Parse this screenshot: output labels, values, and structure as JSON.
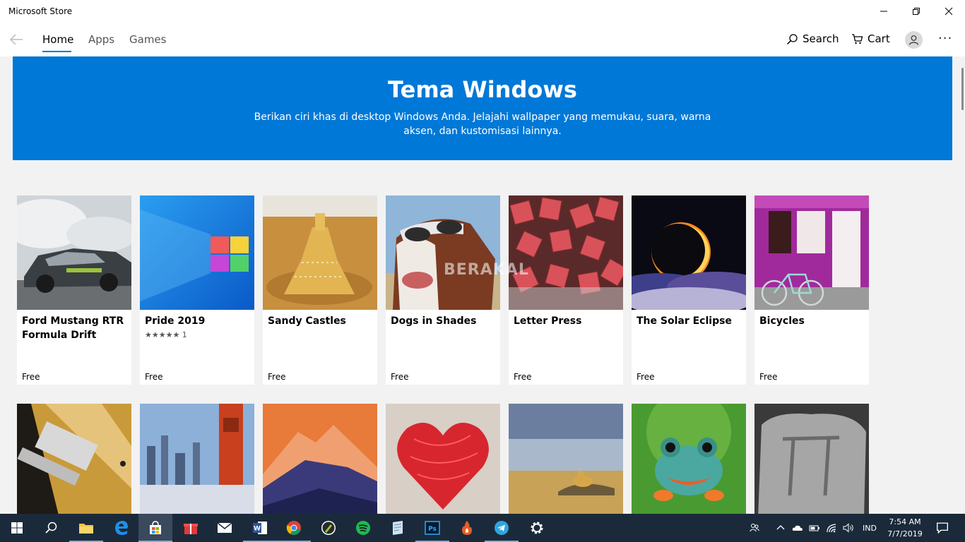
{
  "window": {
    "title": "Microsoft Store"
  },
  "nav": {
    "tabs": [
      {
        "label": "Home"
      },
      {
        "label": "Apps"
      },
      {
        "label": "Games"
      }
    ],
    "search_label": "Search",
    "cart_label": "Cart",
    "more_label": "···"
  },
  "hero": {
    "title": "Tema Windows",
    "description": "Berikan ciri khas di desktop Windows Anda. Jelajahi wallpaper yang memukau, suara, warna aksen, dan kustomisasi lainnya.",
    "color": "#0078d7"
  },
  "watermark": "BERAKAL",
  "row1": [
    {
      "name": "Ford Mustang RTR Formula Drift",
      "price": "Free",
      "icon": "car-drift-image"
    },
    {
      "name": "Pride 2019",
      "rating": "★★★★★ 1",
      "price": "Free",
      "icon": "windows-logo-image"
    },
    {
      "name": "Sandy Castles",
      "price": "Free",
      "icon": "sandcastle-image"
    },
    {
      "name": "Dogs in Shades",
      "price": "Free",
      "icon": "dog-sunglasses-image"
    },
    {
      "name": "Letter Press",
      "price": "Free",
      "icon": "letterpress-image"
    },
    {
      "name": "The Solar Eclipse",
      "price": "Free",
      "icon": "eclipse-image"
    },
    {
      "name": "Bicycles",
      "price": "Free",
      "icon": "bicycle-image"
    }
  ],
  "row2": [
    {
      "icon": "guitar-image"
    },
    {
      "icon": "city-bridge-image"
    },
    {
      "icon": "mountain-image"
    },
    {
      "icon": "yarn-heart-image"
    },
    {
      "icon": "cheetah-image"
    },
    {
      "icon": "frog-image"
    },
    {
      "icon": "stone-carving-image"
    }
  ],
  "taskbar": {
    "language": "IND",
    "time": "7:54 AM",
    "date": "7/7/2019"
  }
}
